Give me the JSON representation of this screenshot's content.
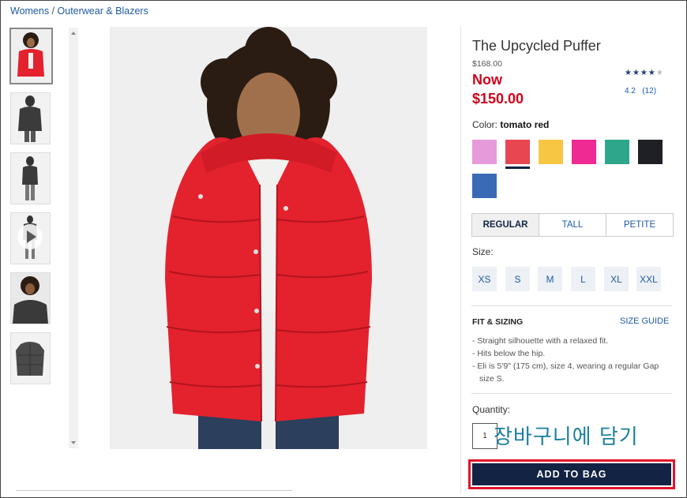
{
  "breadcrumb": {
    "part1": "Womens",
    "separator": " / ",
    "part2": "Outerwear & Blazers"
  },
  "product": {
    "title": "The Upcycled Puffer",
    "original_price": "$168.00",
    "now_label": "Now",
    "sale_price": "$150.00",
    "rating_stars": "★★★★",
    "rating_empty_star": "★",
    "rating_value": "4.2",
    "review_count": "(12)"
  },
  "color": {
    "label": "Color:",
    "selected": "tomato red",
    "swatches": [
      "#e59bd9",
      "#e84650",
      "#f7c744",
      "#f02a93",
      "#2ea68c",
      "#1e2026",
      "#3a6ab5"
    ],
    "selected_index": 1
  },
  "fit_tabs": [
    {
      "label": "REGULAR",
      "selected": true
    },
    {
      "label": "TALL",
      "selected": false
    },
    {
      "label": "PETITE",
      "selected": false
    }
  ],
  "size": {
    "label": "Size:",
    "options": [
      "XS",
      "S",
      "M",
      "L",
      "XL",
      "XXL"
    ]
  },
  "fit_sizing": {
    "heading": "FIT & SIZING",
    "link": "SIZE GUIDE",
    "bullets": [
      "- Straight silhouette with a relaxed fit.",
      "- Hits below the hip.",
      "- Eli is 5'9\" (175 cm), size 4, wearing a regular Gap size S."
    ]
  },
  "quantity": {
    "label": "Quantity:",
    "value": "1"
  },
  "overlay_text": "장바구니에 담기",
  "add_to_bag": "ADD TO BAG",
  "colors": {
    "accent": "#122344",
    "sale": "#d0021b",
    "link": "#1f5aa6",
    "highlight_border": "#e0142b"
  }
}
